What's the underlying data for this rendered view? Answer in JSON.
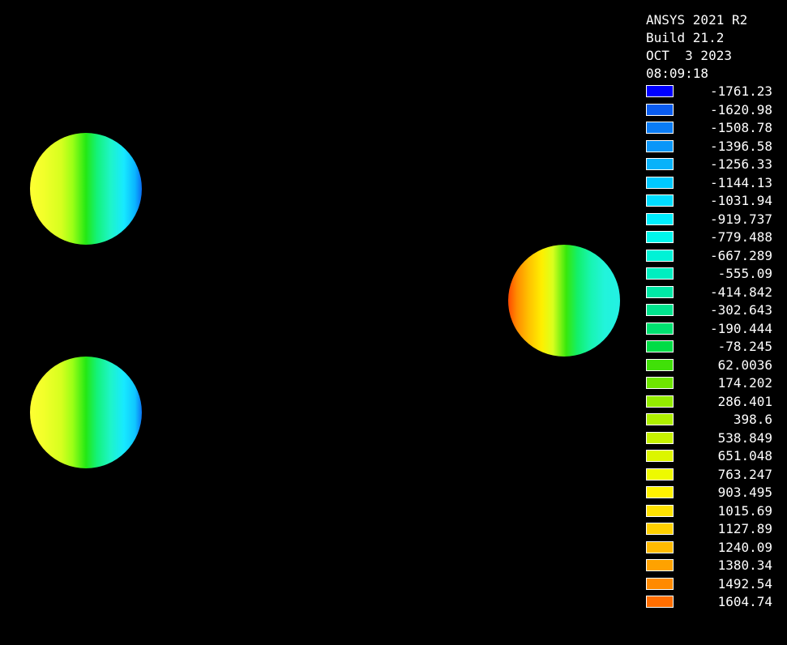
{
  "info": {
    "product": "ANSYS 2021 R2",
    "build": "Build 21.2",
    "date": "OCT  3 2023",
    "time": "08:09:18"
  },
  "legend": [
    {
      "value": "-1761.23",
      "color": "#0000ff"
    },
    {
      "value": "-1620.98",
      "color": "#0a5cf0"
    },
    {
      "value": "-1508.78",
      "color": "#0a7cf5"
    },
    {
      "value": "-1396.58",
      "color": "#0a96f8"
    },
    {
      "value": "-1256.33",
      "color": "#07b2fa"
    },
    {
      "value": "-1144.13",
      "color": "#00c8ff"
    },
    {
      "value": "-1031.94",
      "color": "#00dcff"
    },
    {
      "value": "-919.737",
      "color": "#00eefd"
    },
    {
      "value": "-779.488",
      "color": "#00f6ec"
    },
    {
      "value": "-667.289",
      "color": "#00f2d6"
    },
    {
      "value": "-555.09",
      "color": "#00eec0"
    },
    {
      "value": "-414.842",
      "color": "#00e8a6"
    },
    {
      "value": "-302.643",
      "color": "#00e48e"
    },
    {
      "value": "-190.444",
      "color": "#00e070"
    },
    {
      "value": "-78.245",
      "color": "#00dc46"
    },
    {
      "value": "62.0036",
      "color": "#40e008"
    },
    {
      "value": "174.202",
      "color": "#6ee600"
    },
    {
      "value": "286.401",
      "color": "#94ec00"
    },
    {
      "value": "398.6",
      "color": "#aef000"
    },
    {
      "value": "538.849",
      "color": "#c6f200"
    },
    {
      "value": "651.048",
      "color": "#dcf600"
    },
    {
      "value": "763.247",
      "color": "#eefa00"
    },
    {
      "value": "903.495",
      "color": "#fff200"
    },
    {
      "value": "1015.69",
      "color": "#ffe200"
    },
    {
      "value": "1127.89",
      "color": "#ffd000"
    },
    {
      "value": "1240.09",
      "color": "#ffba00"
    },
    {
      "value": "1380.34",
      "color": "#ffa200"
    },
    {
      "value": "1492.54",
      "color": "#ff8a00"
    },
    {
      "value": "1604.74",
      "color": "#ff6e00"
    }
  ]
}
